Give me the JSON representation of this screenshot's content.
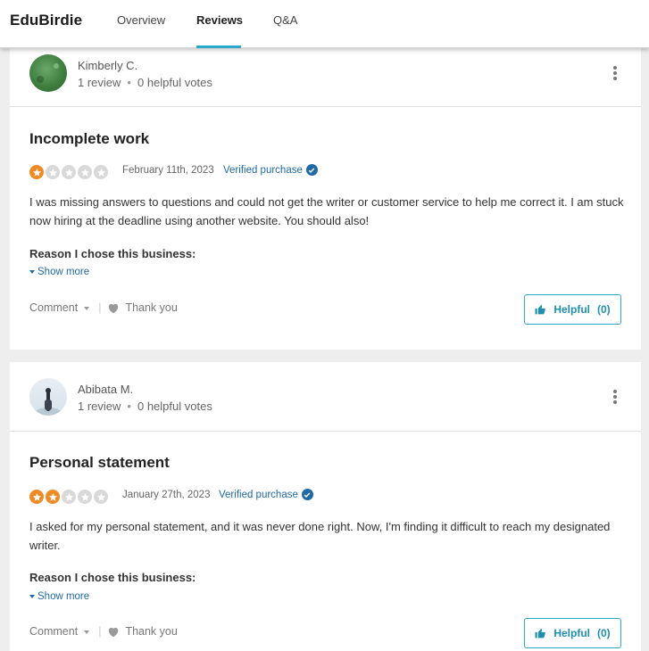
{
  "header": {
    "brand": "EduBirdie",
    "tabs": [
      {
        "label": "Overview",
        "active": false
      },
      {
        "label": "Reviews",
        "active": true
      },
      {
        "label": "Q&A",
        "active": false
      }
    ],
    "accent_color": "#2aa7c9"
  },
  "reviews": [
    {
      "reviewer": "Kimberly C.",
      "review_count": "1 review",
      "helpful_votes": "0 helpful votes",
      "title": "Incomplete work",
      "rating": 1,
      "date": "February 11th, 2023",
      "verified": "Verified purchase",
      "body": "I was missing answers to questions and could not get the writer or customer service to help me correct it. I am stuck now hiring at the deadline using another website. You should also!",
      "reason_label": "Reason I chose this business:",
      "show_more": "Show more",
      "comment_label": "Comment",
      "thank_label": "Thank you",
      "helpful_label": "Helpful",
      "helpful_count": "(0)"
    },
    {
      "reviewer": "Abibata M.",
      "review_count": "1 review",
      "helpful_votes": "0 helpful votes",
      "title": "Personal statement",
      "rating": 2,
      "date": "January 27th, 2023",
      "verified": "Verified purchase",
      "body": "I asked for my personal statement, and it was never done right. Now, I'm finding it difficult to reach my designated writer.",
      "reason_label": "Reason I chose this business:",
      "show_more": "Show more",
      "comment_label": "Comment",
      "thank_label": "Thank you",
      "helpful_label": "Helpful",
      "helpful_count": "(0)"
    }
  ],
  "colors": {
    "star_filled": "#f08a24",
    "star_empty": "#d9d9d9",
    "link_blue": "#1f6aa5"
  }
}
